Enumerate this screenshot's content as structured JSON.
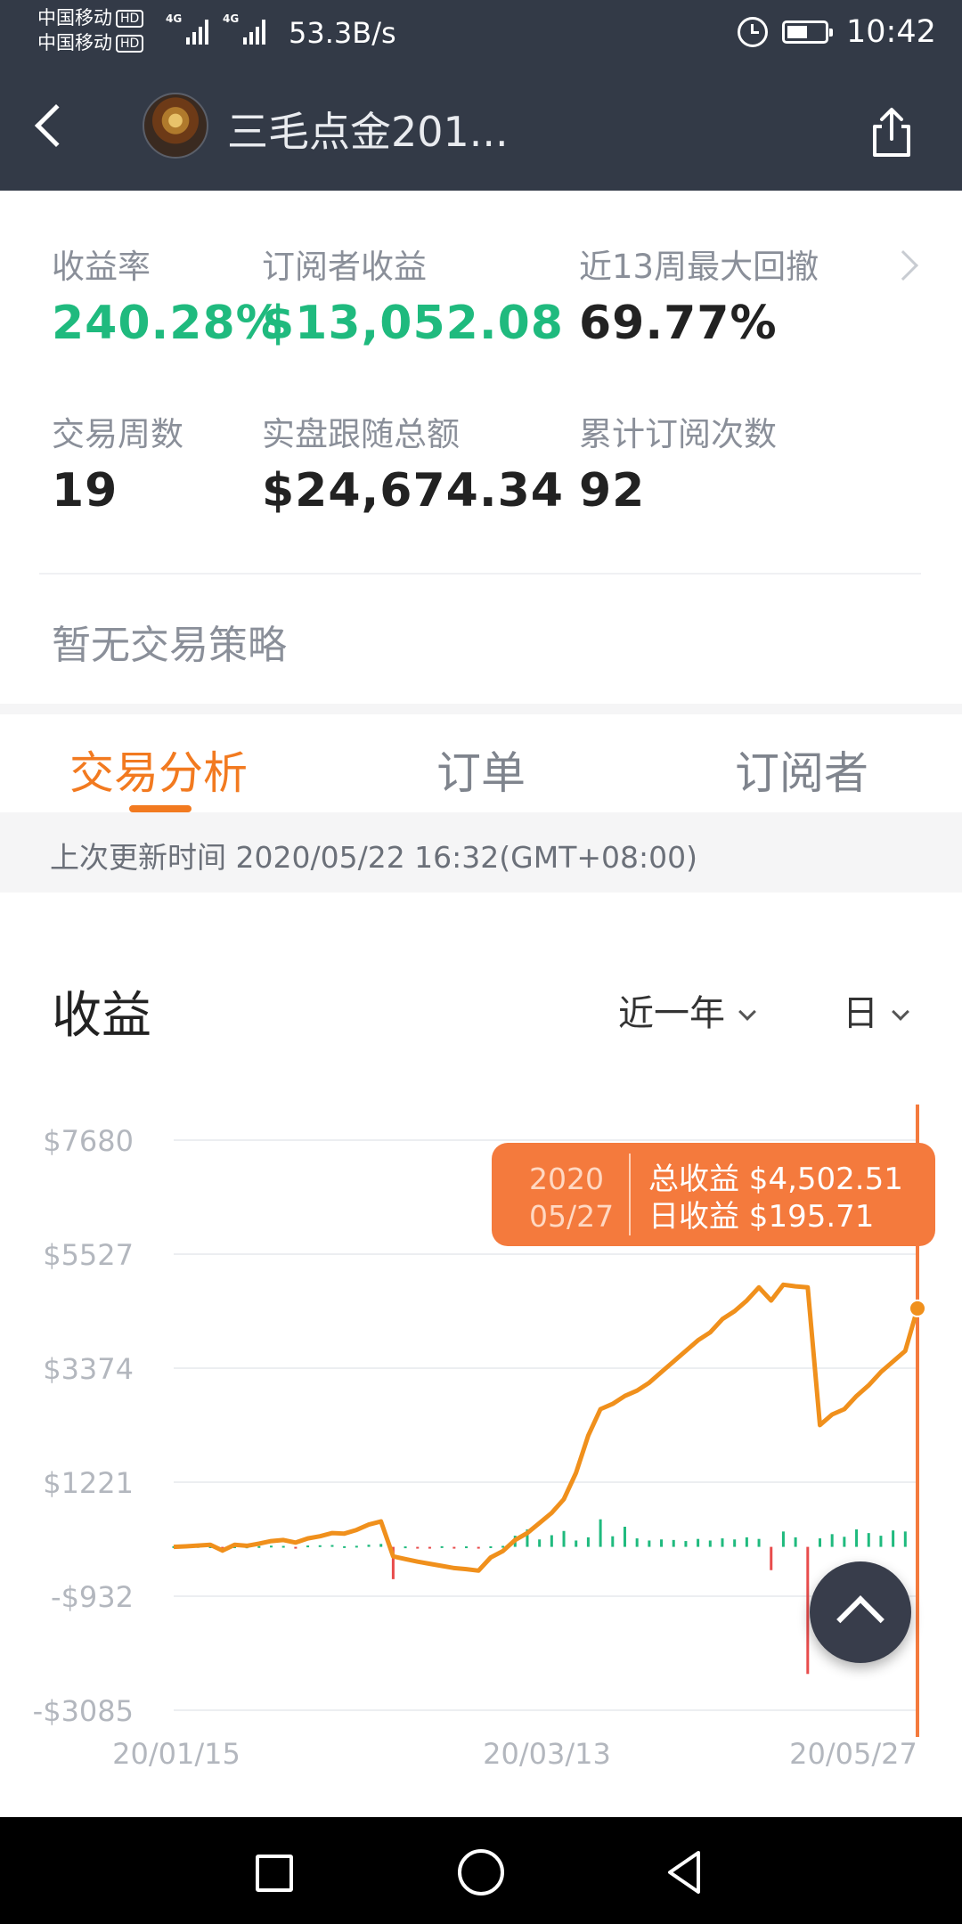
{
  "status_bar": {
    "carrier_1": "中国移动",
    "carrier_2": "中国移动",
    "hd": "HD",
    "net_tag": "4G",
    "net_speed": "53.3B/s",
    "time": "10:42",
    "icons": [
      "signal-icon",
      "alarm-icon",
      "battery-icon"
    ]
  },
  "nav": {
    "title": "三毛点金201...",
    "back_icon": "chevron-left-icon",
    "share_icon": "share-icon"
  },
  "stats": {
    "return_rate": {
      "label": "收益率",
      "value": "240.28%"
    },
    "subscriber_profit": {
      "label": "订阅者收益",
      "value": "$13,052.08"
    },
    "max_drawdown": {
      "label": "近13周最大回撤",
      "value": "69.77%"
    },
    "trade_weeks": {
      "label": "交易周数",
      "value": "19"
    },
    "follow_total": {
      "label": "实盘跟随总额",
      "value": "$24,674.34"
    },
    "subscription_count": {
      "label": "累计订阅次数",
      "value": "92"
    }
  },
  "strategy_text": "暂无交易策略",
  "tabs": [
    {
      "label": "交易分析",
      "active": true
    },
    {
      "label": "订单",
      "active": false
    },
    {
      "label": "订阅者",
      "active": false
    }
  ],
  "update_info": "上次更新时间 2020/05/22 16:32(GMT+08:00)",
  "section": {
    "title": "收益",
    "range_select": "近一年",
    "period_select": "日"
  },
  "colors": {
    "accent": "#f27a20",
    "positive": "#1fba7e",
    "negative": "#e84c4c",
    "line": "#f0901c",
    "header_bg": "#333a47"
  },
  "tooltip": {
    "date_year": "2020",
    "date_md": "05/27",
    "total_line": "总收益 $4,502.51",
    "daily_line": "日收益 $195.71"
  },
  "chart_data": {
    "type": "line",
    "y_ticks": [
      "$7680",
      "$5527",
      "$3374",
      "$1221",
      "-$932",
      "-$3085"
    ],
    "ylim": [
      -3085,
      7680
    ],
    "x_ticks": [
      "20/01/15",
      "20/03/13",
      "20/05/27"
    ],
    "grid": true,
    "series": [
      {
        "values": [
          0,
          10,
          25,
          40,
          -70,
          40,
          20,
          60,
          110,
          130,
          80,
          160,
          200,
          260,
          250,
          320,
          420,
          480,
          -180,
          -230,
          -280,
          -320,
          -360,
          -400,
          -420,
          -450,
          -200,
          -80,
          130,
          260,
          450,
          640,
          900,
          1400,
          2100,
          2600,
          2700,
          2850,
          2950,
          3100,
          3300,
          3500,
          3700,
          3900,
          4050,
          4300,
          4450,
          4650,
          4900,
          4650,
          4950,
          4920,
          4900,
          2300,
          2500,
          2600,
          2850,
          3050,
          3300,
          3500,
          3700,
          4502.51
        ]
      }
    ],
    "daily_bars": [
      12,
      8,
      15,
      10,
      -6,
      9,
      7,
      14,
      22,
      18,
      -20,
      25,
      30,
      35,
      12,
      20,
      40,
      55,
      -610,
      8,
      -9,
      -10,
      12,
      -14,
      9,
      -12,
      10,
      18,
      210,
      330,
      140,
      220,
      300,
      120,
      180,
      520,
      200,
      380,
      160,
      120,
      140,
      130,
      110,
      150,
      120,
      160,
      140,
      180,
      150,
      -440,
      290,
      180,
      -2400,
      160,
      240,
      190,
      330,
      260,
      210,
      310,
      290,
      195.71
    ]
  },
  "fab_icon": "chevron-up-icon",
  "system_nav": [
    "recent-apps-icon",
    "home-icon",
    "back-icon"
  ]
}
